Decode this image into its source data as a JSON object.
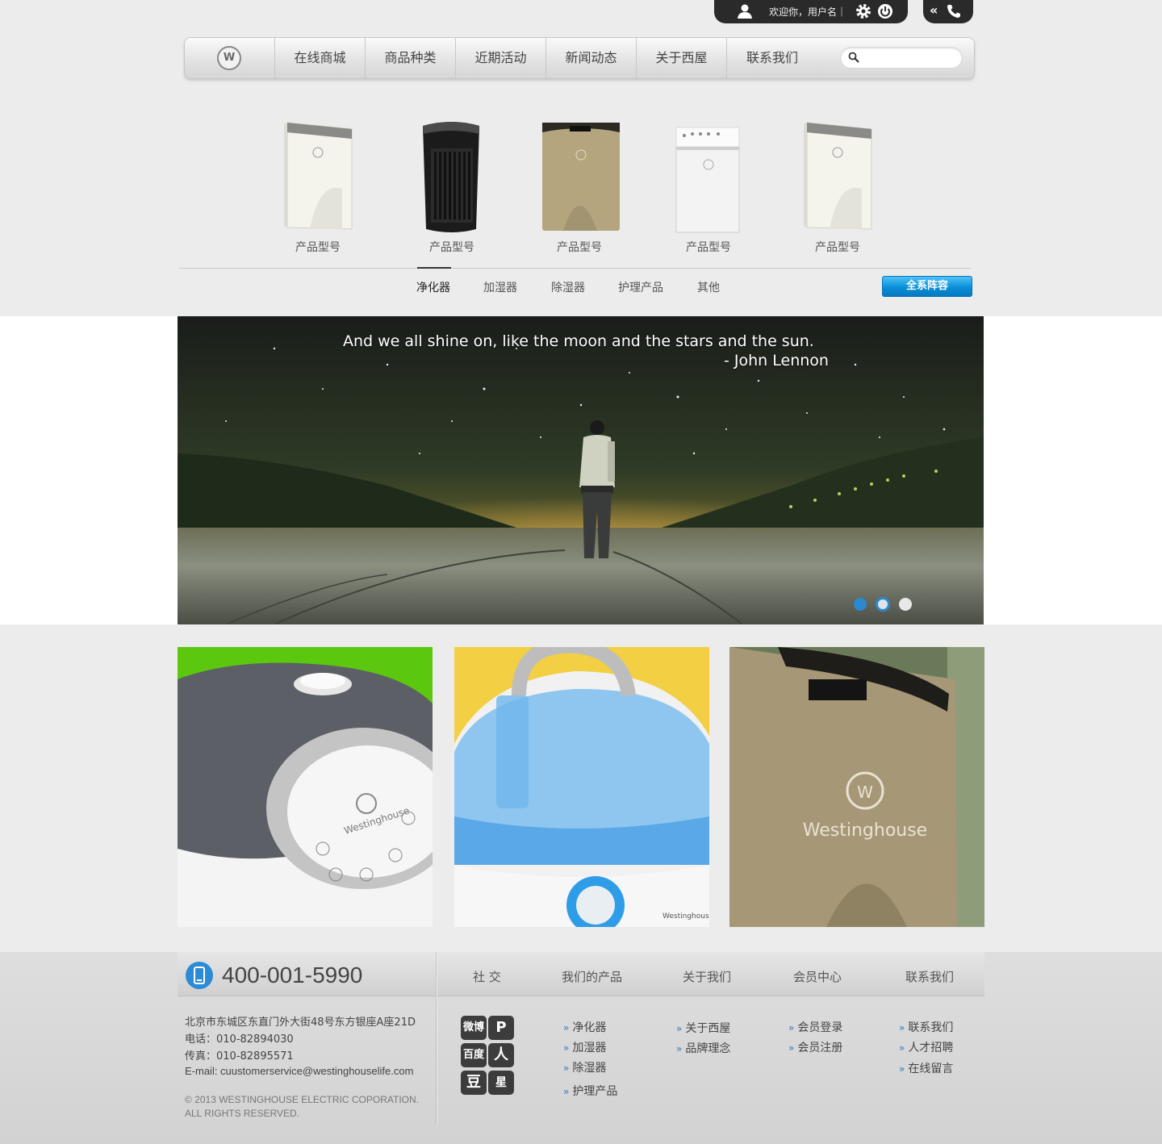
{
  "userbar": {
    "welcome": "欢迎你，用户名｜"
  },
  "phonebar": {
    "chevron": "«"
  },
  "nav": {
    "logo_letter": "W",
    "items": [
      "在线商城",
      "商品种类",
      "近期活动",
      "新闻动态",
      "关于西屋",
      "联系我们"
    ],
    "search_placeholder": ""
  },
  "products": [
    {
      "label": "产品型号",
      "color": "#f2f1ea"
    },
    {
      "label": "产品型号",
      "color": "#1d1d1d"
    },
    {
      "label": "产品型号",
      "color": "#b3a27c"
    },
    {
      "label": "产品型号",
      "color": "#f1f1f1"
    },
    {
      "label": "产品型号",
      "color": "#f2f1ea"
    }
  ],
  "categories": [
    "净化器",
    "加湿器",
    "除湿器",
    "护理产品",
    "其他"
  ],
  "active_category": "净化器",
  "all_button": "全系阵容",
  "banner": {
    "quote": "And we all shine on, like the moon and the stars and the sun.",
    "author": "- John Lennon",
    "slides": 3,
    "active_slide": 2
  },
  "footer": {
    "hotline": "400-001-5990",
    "columns": [
      "社 交",
      "我们的产品",
      "关于我们",
      "会员中心",
      "联系我们"
    ],
    "address": "北京市东城区东直门外大街48号东方银座A座21D",
    "tel": "电话：010-82894030",
    "fax": "传真：010-82895571",
    "email": "E-mail: cuustomerservice@westinghouselife.com",
    "copyright_1": "© 2013 WESTINGHOUSE ELECTRIC COPORATION.",
    "copyright_2": "ALL RIGHTS RESERVED.",
    "social": [
      "微博",
      "P",
      "百度",
      "人",
      "豆",
      "星"
    ],
    "products_links": [
      "净化器",
      "加湿器",
      "除湿器",
      "护理产品"
    ],
    "about_links": [
      "关于西屋",
      "品牌理念"
    ],
    "member_links": [
      "会员登录",
      "会员注册"
    ],
    "contact_links": [
      "联系我们",
      "人才招聘",
      "在线留言"
    ]
  },
  "colors": {
    "accent": "#0a8fd8",
    "dark": "#2a2a2a"
  }
}
